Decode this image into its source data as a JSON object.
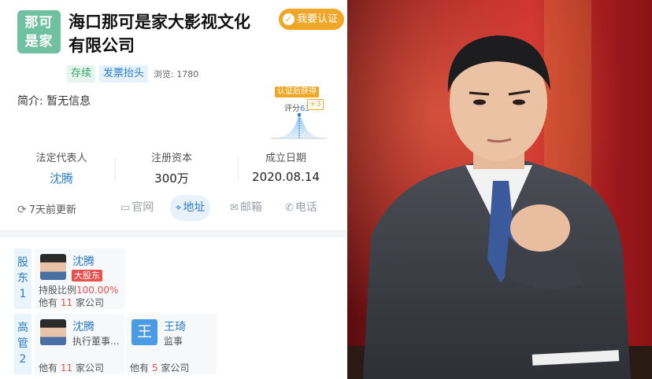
{
  "company": {
    "logo_line1": "那可",
    "logo_line2": "是家",
    "name": "海口那可是家大影视文化有限公司",
    "verify_button": "我要认证",
    "tag_status": "存续",
    "tag_invoice": "发票抬头",
    "views": "浏览: 1780",
    "intro": "简介:  暂无信息"
  },
  "score": {
    "badge": "认证后获得",
    "label": "评分",
    "value": "63",
    "plus": "+3"
  },
  "stats": [
    {
      "label": "法定代表人",
      "value": "沈腾"
    },
    {
      "label": "注册资本",
      "value": "300万"
    },
    {
      "label": "成立日期",
      "value": "2020.08.14"
    }
  ],
  "actions": {
    "updated": "7天前更新",
    "website": "官网",
    "address": "地址",
    "email": "邮箱",
    "phone": "电话"
  },
  "shareholders": {
    "label": "股东1",
    "people": [
      {
        "name": "沈腾",
        "badge": "大股东",
        "ratio_label": "持股比例",
        "ratio": "100.00%",
        "companies_prefix": "他有",
        "companies_count": "11",
        "companies_suffix": "家公司"
      }
    ]
  },
  "executives": {
    "label": "高管2",
    "people": [
      {
        "name": "沈腾",
        "role": "执行董事...",
        "companies_prefix": "他有",
        "companies_count": "11",
        "companies_suffix": "家公司"
      },
      {
        "name": "王琦",
        "avatar_letter": "王",
        "role": "监事",
        "companies_prefix": "他有",
        "companies_count": "5",
        "companies_suffix": "家公司"
      }
    ]
  },
  "colors": {
    "brand_green": "#6fc1a2",
    "accent_blue": "#2d7cc6",
    "verify_orange": "#f0a728",
    "badge_red": "#e8504e"
  }
}
